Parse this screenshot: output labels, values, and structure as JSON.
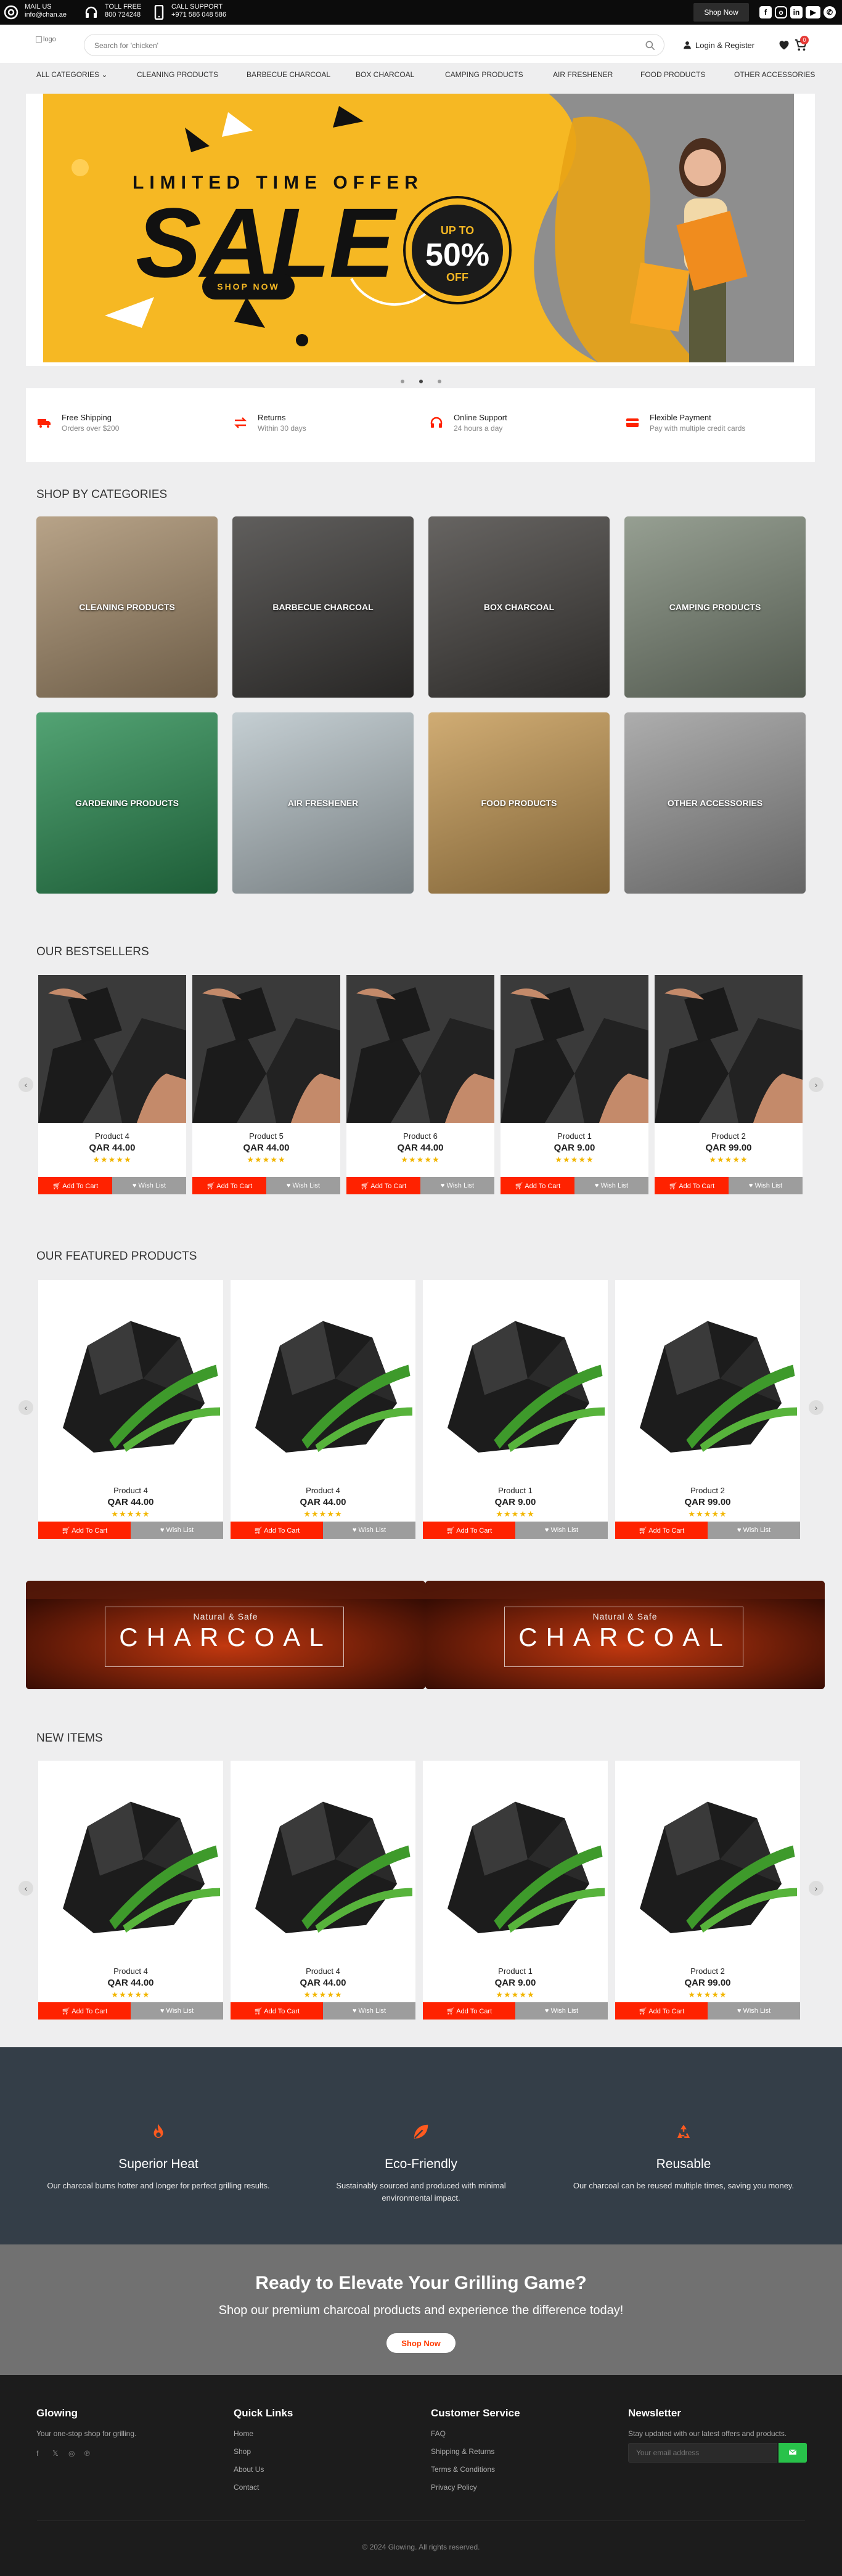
{
  "topbar": {
    "mail_label": "MAIL US",
    "mail_value": "info@chan.ae",
    "toll_label": "TOLL FREE",
    "toll_value": "800 724248",
    "call_label": "CALL SUPPORT",
    "call_value": "+971 586 048 586",
    "shop_now": "Shop Now",
    "social_icons": [
      "facebook-icon",
      "instagram-icon",
      "linkedin-icon",
      "youtube-icon",
      "whatsapp-icon"
    ]
  },
  "header": {
    "logo_alt": "logo",
    "search_placeholder": "Search for 'chicken'",
    "login_label": "Login & Register",
    "cart_count": "0"
  },
  "nav": {
    "items": [
      "ALL CATEGORIES",
      "CLEANING PRODUCTS",
      "BARBECUE CHARCOAL",
      "BOX CHARCOAL",
      "CAMPING PRODUCTS",
      "AIR FRESHENER",
      "FOOD PRODUCTS",
      "OTHER ACCESSORIES"
    ]
  },
  "hero": {
    "limited": "LIMITED TIME OFFER",
    "sale": "SALE",
    "up_to": "UP TO",
    "percent": "50%",
    "off": "OFF",
    "button": "SHOP NOW",
    "active_slide": 1,
    "slides": 3
  },
  "features": [
    {
      "icon": "truck-icon",
      "title": "Free Shipping",
      "sub": "Orders over $200"
    },
    {
      "icon": "returns-icon",
      "title": "Returns",
      "sub": "Within 30 days"
    },
    {
      "icon": "headset-icon",
      "title": "Online Support",
      "sub": "24 hours a day"
    },
    {
      "icon": "card-icon",
      "title": "Flexible Payment",
      "sub": "Pay with multiple credit cards"
    }
  ],
  "categories_title": "SHOP BY CATEGORIES",
  "categories": [
    {
      "label": "CLEANING PRODUCTS",
      "color": "#a88f6e"
    },
    {
      "label": "BARBECUE CHARCOAL",
      "color": "#3d3b39"
    },
    {
      "label": "BOX CHARCOAL",
      "color": "#45423f"
    },
    {
      "label": "CAMPING PRODUCTS",
      "color": "#7f8a7a"
    },
    {
      "label": "GARDENING PRODUCTS",
      "color": "#2d8f55"
    },
    {
      "label": "AIR FRESHENER",
      "color": "#b8c4c9"
    },
    {
      "label": "FOOD PRODUCTS",
      "color": "#c69a55"
    },
    {
      "label": "OTHER ACCESSORIES",
      "color": "#9b9b9b"
    }
  ],
  "bestsellers_title": "OUR BESTSELLERS",
  "bestsellers": [
    {
      "name": "Product 4",
      "price": "QAR 44.00",
      "rating": 5
    },
    {
      "name": "Product 5",
      "price": "QAR 44.00",
      "rating": 5
    },
    {
      "name": "Product 6",
      "price": "QAR 44.00",
      "rating": 5
    },
    {
      "name": "Product 1",
      "price": "QAR 9.00",
      "rating": 5
    },
    {
      "name": "Product 2",
      "price": "QAR 99.00",
      "rating": 5
    }
  ],
  "featured_title": "OUR FEATURED PRODUCTS",
  "featured": [
    {
      "name": "Product 4",
      "price": "QAR 44.00",
      "rating": 5
    },
    {
      "name": "Product 4",
      "price": "QAR 44.00",
      "rating": 5
    },
    {
      "name": "Product 1",
      "price": "QAR 9.00",
      "rating": 5
    },
    {
      "name": "Product 2",
      "price": "QAR 99.00",
      "rating": 5
    }
  ],
  "new_title": "NEW ITEMS",
  "new_items": [
    {
      "name": "Product 4",
      "price": "QAR 44.00",
      "rating": 5
    },
    {
      "name": "Product 4",
      "price": "QAR 44.00",
      "rating": 5
    },
    {
      "name": "Product 1",
      "price": "QAR 9.00",
      "rating": 5
    },
    {
      "name": "Product 2",
      "price": "QAR 99.00",
      "rating": 5
    }
  ],
  "add_to_cart": "Add To Cart",
  "wish_list": "Wish List",
  "banners": [
    {
      "natural": "Natural & Safe",
      "title": "CHARCOAL"
    },
    {
      "natural": "Natural & Safe",
      "title": "CHARCOAL"
    }
  ],
  "why": [
    {
      "icon": "flame-icon",
      "title": "Superior Heat",
      "desc": "Our charcoal burns hotter and longer for perfect grilling results."
    },
    {
      "icon": "leaf-icon",
      "title": "Eco-Friendly",
      "desc": "Sustainably sourced and produced with minimal environmental impact."
    },
    {
      "icon": "recycle-icon",
      "title": "Reusable",
      "desc": "Our charcoal can be reused multiple times, saving you money."
    }
  ],
  "cta": {
    "title": "Ready to Elevate Your Grilling Game?",
    "sub": "Shop our premium charcoal products and experience the difference today!",
    "button": "Shop Now"
  },
  "footer": {
    "brand": "Glowing",
    "tagline": "Your one-stop shop for grilling.",
    "quick_title": "Quick Links",
    "quick_links": [
      "Home",
      "Shop",
      "About Us",
      "Contact"
    ],
    "service_title": "Customer Service",
    "service_links": [
      "FAQ",
      "Shipping & Returns",
      "Terms & Conditions",
      "Privacy Policy"
    ],
    "newsletter_title": "Newsletter",
    "newsletter_text": "Stay updated with our latest offers and products.",
    "newsletter_placeholder": "Your email address",
    "copyright": "© 2024 Glowing. All rights reserved."
  },
  "colors": {
    "accent": "#ff2200",
    "hero": "#f6b823",
    "dark": "#343e48",
    "footer": "#1c1c1c"
  }
}
